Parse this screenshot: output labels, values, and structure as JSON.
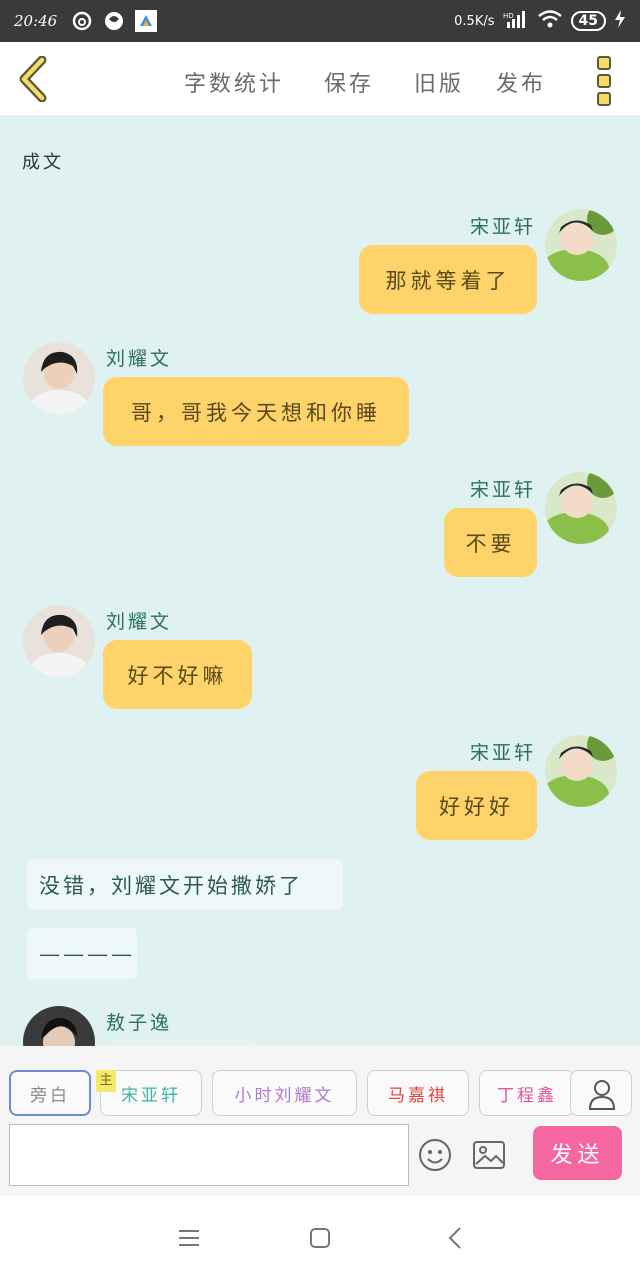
{
  "status_bar": {
    "time": "20:46",
    "speed": "0.5K/s",
    "battery": "45"
  },
  "toolbar": {
    "word_count": "字数统计",
    "save": "保存",
    "old_version": "旧版",
    "publish": "发布"
  },
  "chat": {
    "top_label": "成文",
    "messages": [
      {
        "side": "right",
        "name": "宋亚轩",
        "text": "那就等着了"
      },
      {
        "side": "left",
        "name": "刘耀文",
        "text": "哥，哥我今天想和你睡"
      },
      {
        "side": "right",
        "name": "宋亚轩",
        "text": "不要"
      },
      {
        "side": "left",
        "name": "刘耀文",
        "text": "好不好嘛"
      },
      {
        "side": "right",
        "name": "宋亚轩",
        "text": "好好好"
      }
    ],
    "narration_1": "没错，刘耀文开始撒娇了",
    "narration_2": "————",
    "last_name": "敖子逸"
  },
  "input": {
    "roles": [
      "旁白",
      "宋亚轩",
      "小时刘耀文",
      "马嘉祺",
      "丁程鑫"
    ],
    "main_tag": "主",
    "send": "发送",
    "colors": {
      "role_song": "#3bb5a8",
      "role_liu": "#b07ad0",
      "role_ma": "#e0453a",
      "role_ding": "#e05898",
      "send_bg": "#f567a0"
    }
  }
}
